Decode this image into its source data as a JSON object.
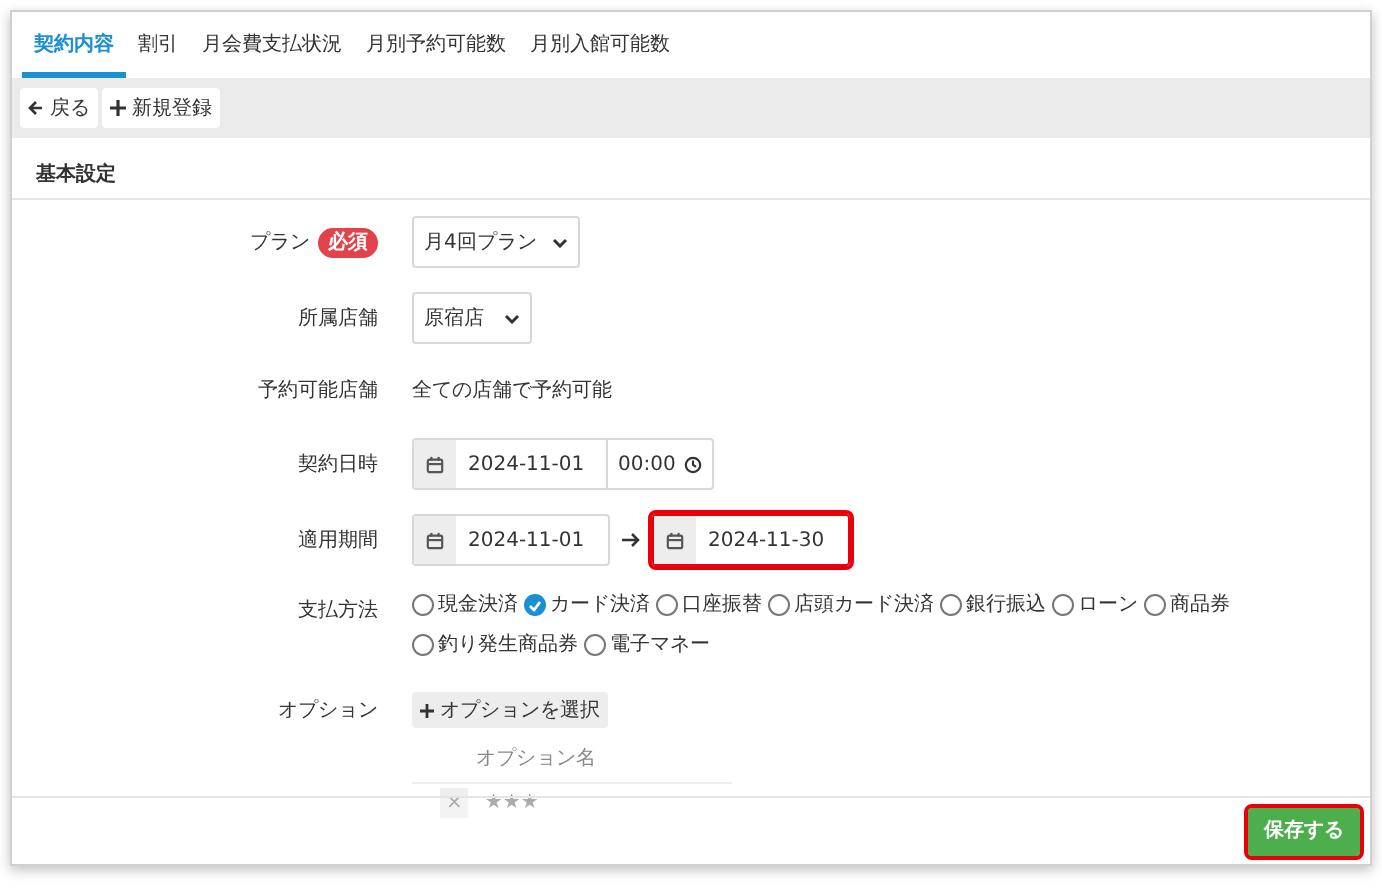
{
  "tabs": [
    {
      "label": "契約内容",
      "selected": true
    },
    {
      "label": "割引",
      "selected": false
    },
    {
      "label": "月会費支払状況",
      "selected": false
    },
    {
      "label": "月別予約可能数",
      "selected": false
    },
    {
      "label": "月別入館可能数",
      "selected": false
    }
  ],
  "toolbar": [
    {
      "kind": "back",
      "label": "戻る"
    },
    {
      "kind": "add",
      "label": "新規登録"
    }
  ],
  "section_title": "基本設定",
  "form": {
    "plan": {
      "label": "プラン",
      "required_badge": "必須",
      "value": "月4回プラン"
    },
    "store": {
      "label": "所属店舗",
      "value": "原宿店"
    },
    "bookable_stores": {
      "label": "予約可能店舗",
      "value": "全ての店舗で予約可能"
    },
    "contract_datetime": {
      "label": "契約日時",
      "date": "2024-11-01",
      "time": "00:00"
    },
    "period": {
      "label": "適用期間",
      "start": {
        "value": "2024-11-01",
        "highlighted": false
      },
      "end": {
        "value": "2024-11-30",
        "highlighted": true
      }
    },
    "payment": {
      "label": "支払方法",
      "options": [
        {
          "label": "現金決済",
          "selected": false
        },
        {
          "label": "カード決済",
          "selected": true
        },
        {
          "label": "口座振替",
          "selected": false
        },
        {
          "label": "店頭カード決済",
          "selected": false
        },
        {
          "label": "銀行振込",
          "selected": false
        },
        {
          "label": "ローン",
          "selected": false
        },
        {
          "label": "商品券",
          "selected": false
        },
        {
          "label": "釣り発生商品券",
          "selected": false
        },
        {
          "label": "電子マネー",
          "selected": false
        }
      ]
    },
    "options": {
      "label": "オプション",
      "button": "オプションを選択",
      "table_header": "オプション名",
      "rows": [
        {
          "remove": "×",
          "name": "★★★"
        }
      ]
    }
  },
  "save_button": {
    "label": "保存する",
    "highlighted": true
  }
}
